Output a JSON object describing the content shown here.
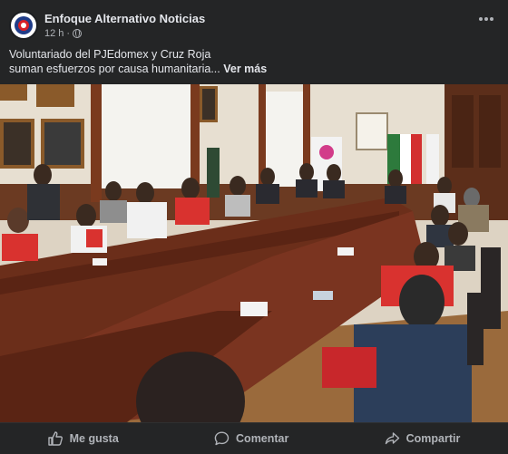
{
  "post": {
    "author": "Enfoque Alternativo Noticias",
    "time": "12 h",
    "separator": "·",
    "text_line1": "Voluntariado del PJEdomex y Cruz Roja",
    "text_line2": "suman esfuerzos por causa humanitaria...",
    "see_more": "Ver más",
    "privacy_icon": "globe-icon",
    "menu_icon": "more-options-icon"
  },
  "actions": {
    "like": "Me gusta",
    "comment": "Comentar",
    "share": "Compartir"
  },
  "colors": {
    "background": "#242526",
    "text": "#e4e6eb",
    "secondary": "#b0b3b8",
    "avatar_red": "#d81f26",
    "avatar_blue": "#1f3c88"
  }
}
